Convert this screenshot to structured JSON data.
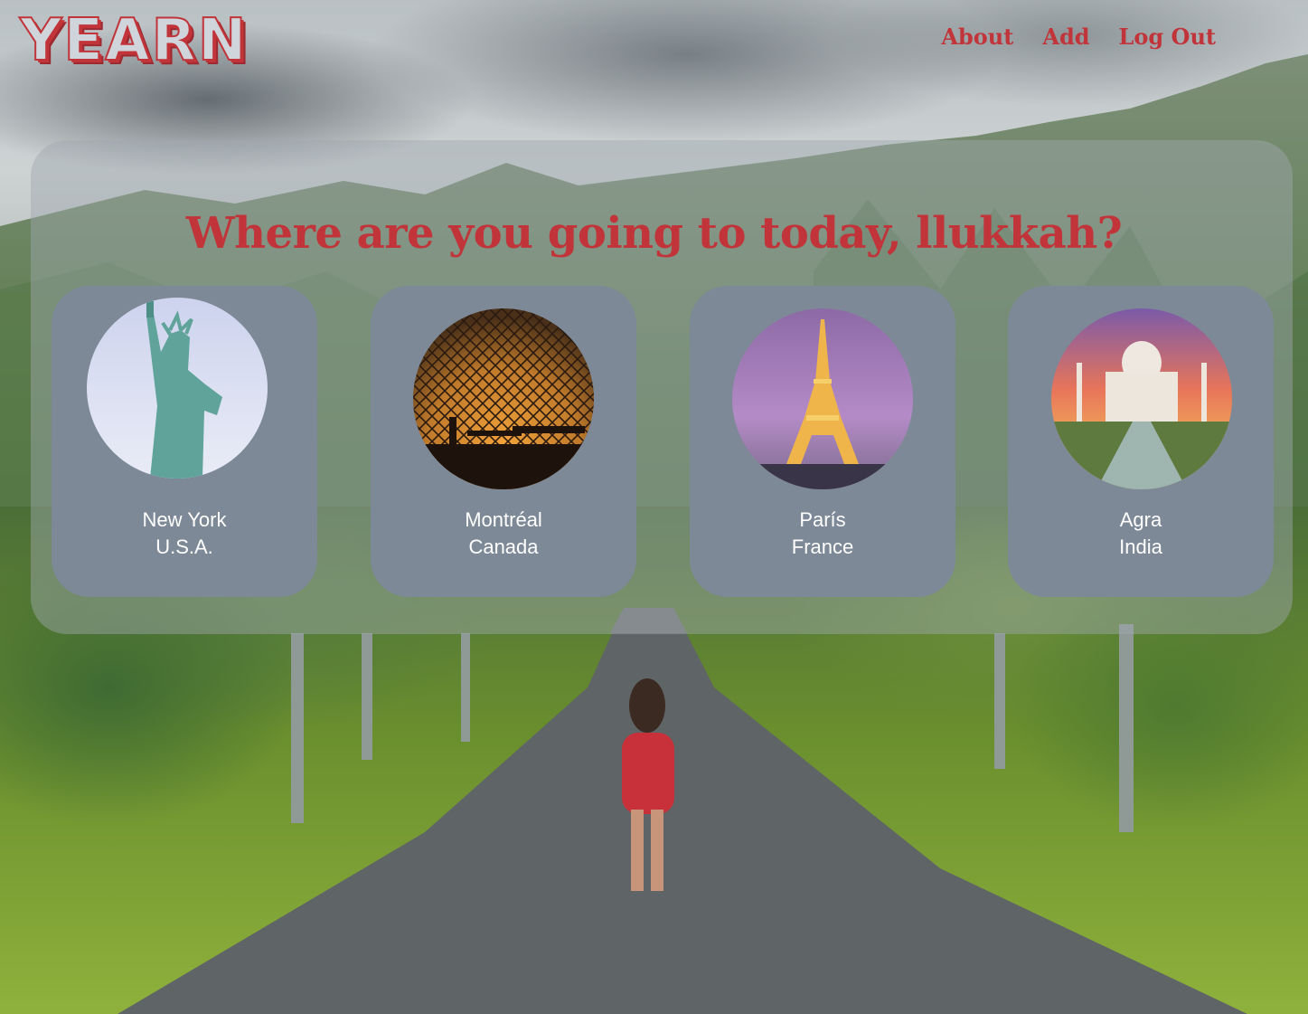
{
  "app": {
    "logo": "YEARN"
  },
  "nav": {
    "about": "About",
    "add": "Add",
    "logout": "Log Out"
  },
  "main": {
    "greeting": "Where are you going to today, llukkah?",
    "destinations": [
      {
        "city": "New York",
        "country": "U.S.A.",
        "photo": "statue-of-liberty"
      },
      {
        "city": "Montréal",
        "country": "Canada",
        "photo": "biosphere-dome"
      },
      {
        "city": "París",
        "country": "France",
        "photo": "eiffel-tower"
      },
      {
        "city": "Agra",
        "country": "India",
        "photo": "taj-mahal"
      }
    ]
  },
  "colors": {
    "accent": "#c0343a",
    "card": "#7d8996"
  }
}
